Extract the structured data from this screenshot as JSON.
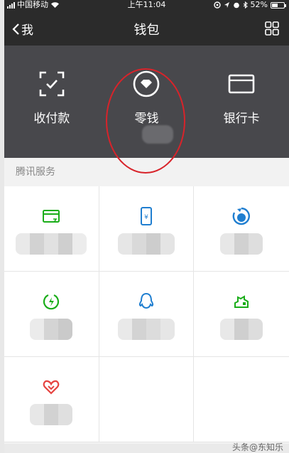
{
  "status_bar": {
    "carrier": "中国移动",
    "time": "上午11:04",
    "battery_percent": "52%",
    "battery_level": 0.52
  },
  "nav": {
    "back_label": "我",
    "title": "钱包"
  },
  "top_actions": [
    {
      "label": "收付款",
      "icon": "scan-pay-icon"
    },
    {
      "label": "零钱",
      "icon": "change-wallet-icon"
    },
    {
      "label": "银行卡",
      "icon": "bank-card-icon"
    }
  ],
  "services": {
    "section_title": "腾讯服务",
    "items": [
      {
        "icon": "credit-card-repay-icon",
        "color": "#1aad19"
      },
      {
        "icon": "mobile-topup-icon",
        "color": "#1f7ed0"
      },
      {
        "icon": "wealth-management-icon",
        "color": "#1f7ed0"
      },
      {
        "icon": "utility-bill-icon",
        "color": "#1aad19"
      },
      {
        "icon": "qq-coin-icon",
        "color": "#1f7ed0"
      },
      {
        "icon": "city-service-icon",
        "color": "#1aad19"
      },
      {
        "icon": "charity-icon",
        "color": "#e64340"
      }
    ]
  },
  "watermark": "头条@东知乐"
}
